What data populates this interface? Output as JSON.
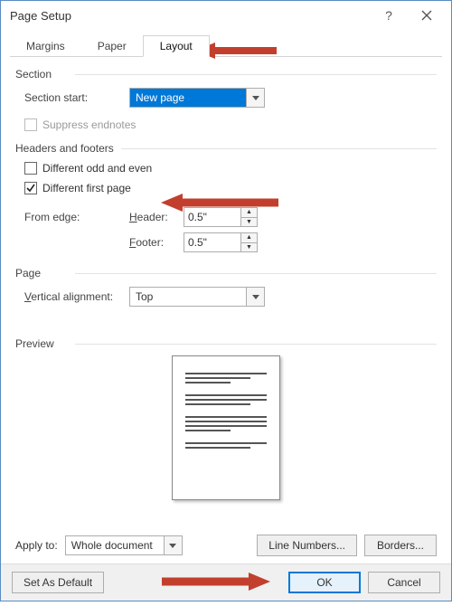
{
  "title": "Page Setup",
  "tabs": {
    "margins": "Margins",
    "paper": "Paper",
    "layout": "Layout"
  },
  "section": {
    "group": "Section",
    "start_label": "Section start:",
    "start_value": "New page",
    "suppress_endnotes": "Suppress endnotes"
  },
  "hf": {
    "group": "Headers and footers",
    "diff_odd_even": "Different odd and even",
    "diff_first": "Different first page",
    "from_edge": "From edge:",
    "header_label": "eader:",
    "header_letter": "H",
    "footer_label": "ooter:",
    "footer_letter": "F",
    "header_value": "0.5\"",
    "footer_value": "0.5\""
  },
  "page": {
    "group": "Page",
    "valign_label": "ertical alignment:",
    "valign_letter": "V",
    "valign_value": "Top"
  },
  "preview": {
    "group": "Preview"
  },
  "apply": {
    "label": "Apply to:",
    "value": "Whole document"
  },
  "buttons": {
    "line_numbers": "Line Numbers...",
    "borders": "Borders...",
    "set_default": "Set As Default",
    "ok": "OK",
    "cancel": "Cancel"
  },
  "arrow_color": "#c23f2e"
}
